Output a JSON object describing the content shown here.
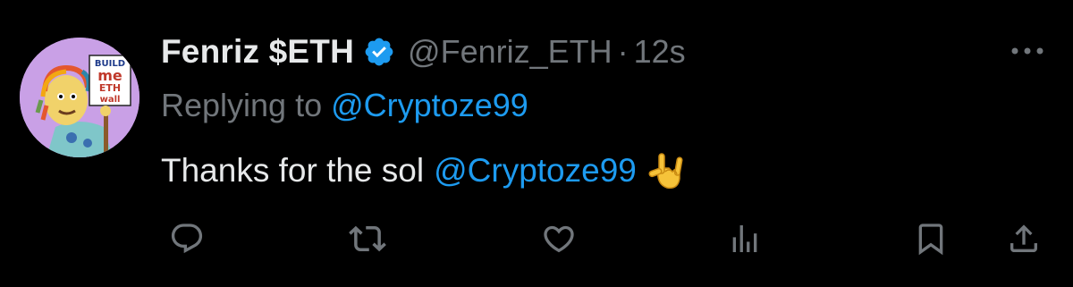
{
  "tweet": {
    "display_name": "Fenriz $ETH",
    "handle": "@Fenriz_ETH",
    "separator": "·",
    "time": "12s",
    "reply_prefix": "Replying to",
    "reply_to": "@Cryptoze99",
    "text_before": "Thanks for the sol",
    "text_mention": "@Cryptoze99",
    "emoji": "🤟",
    "avatar_sign_lines": [
      "BUILD",
      "me",
      "ETH",
      "wall"
    ]
  },
  "icons": {
    "verified": "verified-badge-icon",
    "more": "more-icon",
    "reply": "reply-icon",
    "retweet": "retweet-icon",
    "like": "heart-icon",
    "views": "views-icon",
    "bookmark": "bookmark-icon",
    "share": "share-icon"
  },
  "colors": {
    "background": "#000000",
    "primary_text": "#e7e9ea",
    "secondary_text": "#71767b",
    "accent": "#1d9bf0",
    "avatar_bg": "#c9a0e6"
  }
}
